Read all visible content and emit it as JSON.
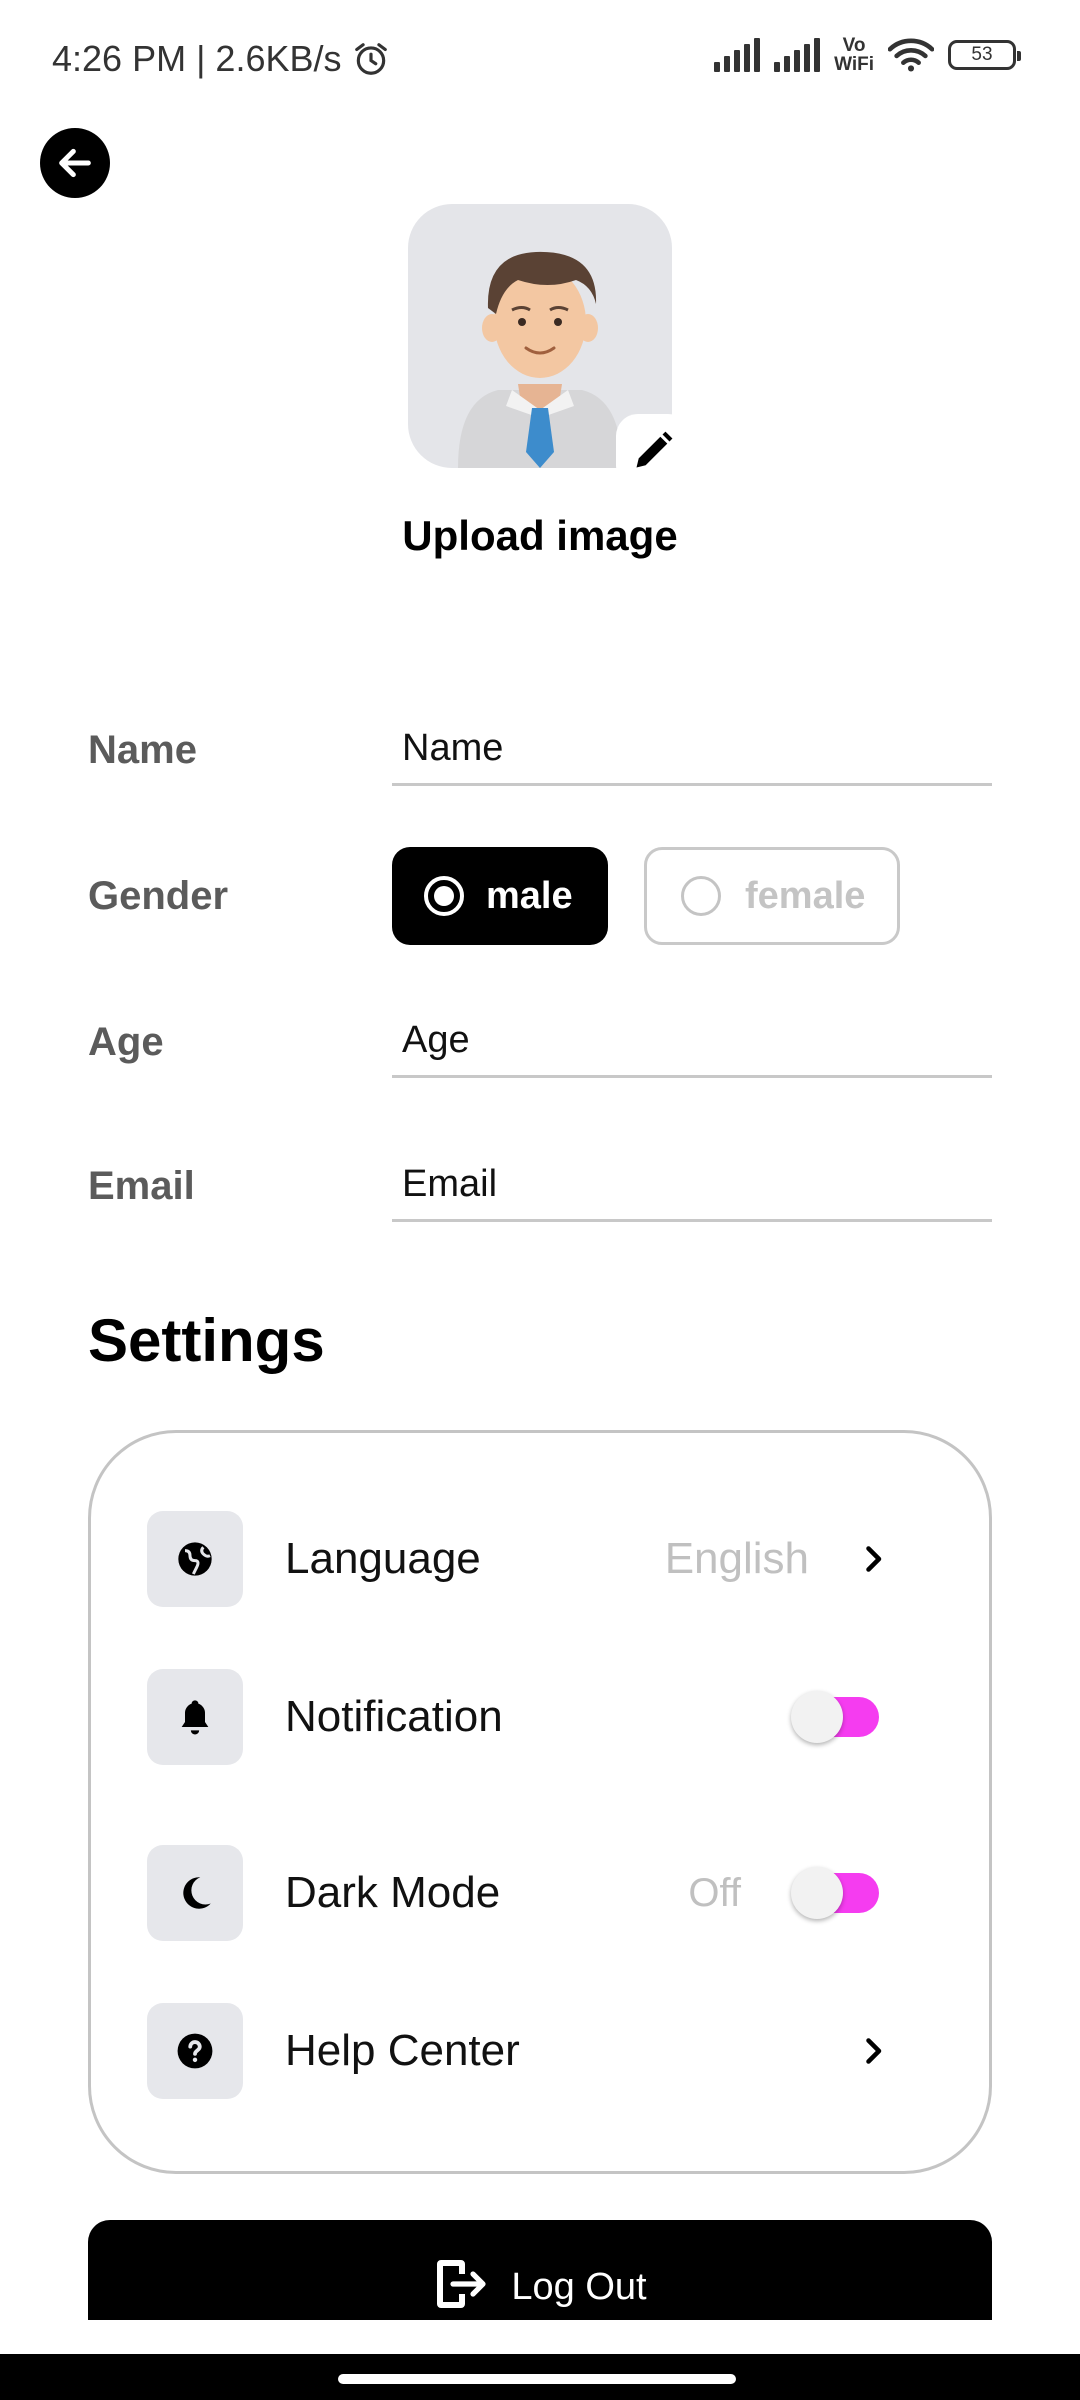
{
  "status_bar": {
    "time_speed": "4:26 PM | 2.6KB/s",
    "vowifi_top": "Vo",
    "vowifi_bottom": "WiFi",
    "battery": "53"
  },
  "profile": {
    "upload_label": "Upload image"
  },
  "form": {
    "name_label": "Name",
    "name_placeholder": "Name",
    "gender_label": "Gender",
    "gender_options": [
      "male",
      "female"
    ],
    "gender_selected": "male",
    "age_label": "Age",
    "age_placeholder": "Age",
    "email_label": "Email",
    "email_placeholder": "Email"
  },
  "settings": {
    "title": "Settings",
    "items": [
      {
        "label": "Language",
        "value": "English",
        "icon": "globe-icon",
        "control": "chevron"
      },
      {
        "label": "Notification",
        "icon": "bell-icon",
        "control": "toggle",
        "toggle_on": true
      },
      {
        "label": "Dark Mode",
        "value": "Off",
        "icon": "moon-icon",
        "control": "toggle",
        "toggle_on": true
      },
      {
        "label": "Help Center",
        "icon": "question-icon",
        "control": "chevron"
      }
    ]
  },
  "logout": {
    "label": "Log Out"
  },
  "colors": {
    "toggle_accent": "#f53cf0",
    "primary": "#000000"
  }
}
